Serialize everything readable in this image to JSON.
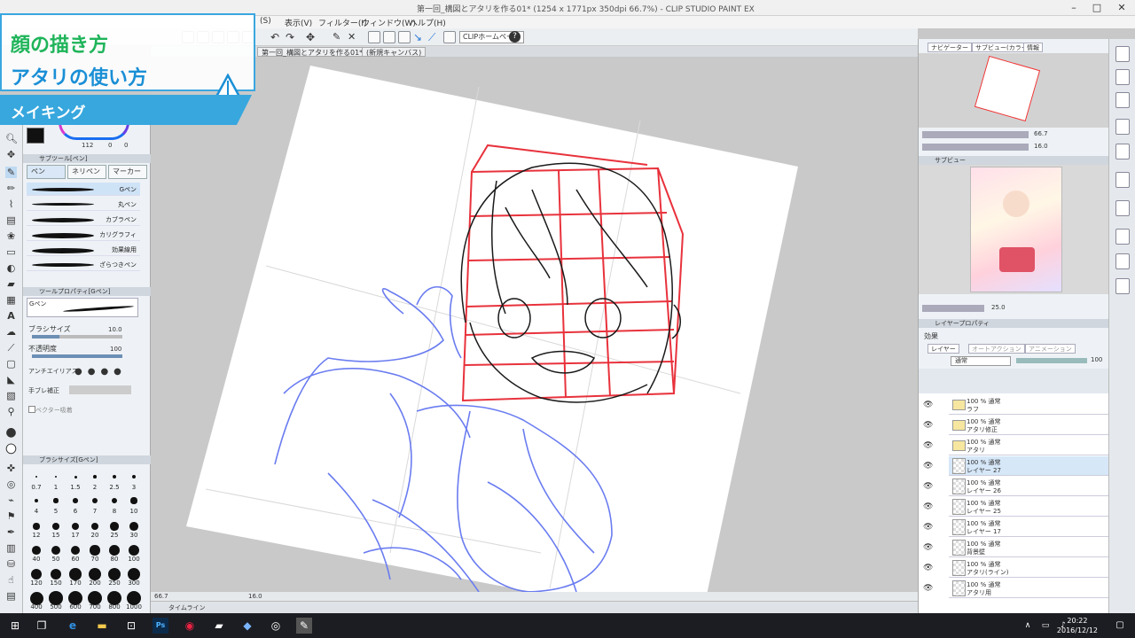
{
  "window": {
    "title": "第一回_構図とアタリを作る01* (1254 x 1771px 350dpi 66.7%) - CLIP STUDIO PAINT EX",
    "controls": [
      "–",
      "□",
      "✕"
    ]
  },
  "menu": {
    "items": [
      "(S)",
      "表示(V)",
      "フィルター(I)",
      "ウィンドウ(W)",
      "ヘルプ(H)"
    ]
  },
  "command_bar": {
    "clip_home_label": "CLIPホームページ",
    "help_label": "?"
  },
  "document_tabs": [
    "第一回_構図とアタリを作る01*",
    "(新規キャンバス)"
  ],
  "overlay": {
    "title": "顔の描き方",
    "subtitle": "アタリの使い方",
    "band": "メイキング"
  },
  "color_panel": {
    "values": [
      "112",
      "0",
      "0"
    ]
  },
  "subtool_panel": {
    "header": "サブツール[ペン]",
    "tabs": [
      "ペン",
      "ネリペン",
      "マーカー"
    ],
    "brushes": [
      "Gペン",
      "丸ペン",
      "カブラペン",
      "カリグラフィ",
      "効果線用",
      "ざらつきペン"
    ]
  },
  "tool_property": {
    "header": "ツールプロパティ[Gペン]",
    "brush_name": "Gペン",
    "rows": [
      {
        "label": "ブラシサイズ",
        "value": "10.0"
      },
      {
        "label": "不透明度",
        "value": "100"
      },
      {
        "label": "アンチエイリアス",
        "value": ""
      },
      {
        "label": "手ブレ補正",
        "value": ""
      },
      {
        "label": "ベクター吸着",
        "value": ""
      }
    ]
  },
  "brush_size_panel": {
    "header": "ブラシサイズ[Gペン]",
    "sizes_row1": [
      "0.7",
      "1",
      "1.5",
      "2",
      "2.5",
      "3"
    ],
    "sizes_row2": [
      "4",
      "5",
      "6",
      "7",
      "8",
      "10"
    ],
    "sizes_row3": [
      "12",
      "15",
      "17",
      "20",
      "25",
      "30"
    ],
    "sizes_row4": [
      "40",
      "50",
      "60",
      "70",
      "80",
      "100"
    ],
    "sizes_row5": [
      "120",
      "150",
      "170",
      "200",
      "250",
      "300"
    ],
    "sizes_row6": [
      "400",
      "500",
      "600",
      "700",
      "800",
      "1000"
    ]
  },
  "status": {
    "zoom": "66.7",
    "angle": "16.0",
    "timeline_label": "タイムライン"
  },
  "navigator": {
    "tabs": [
      "ナビゲーター",
      "サブビュー(カラー)",
      "情報"
    ],
    "zoom": "66.7",
    "angle": "16.0"
  },
  "subview": {
    "header": "サブビュー",
    "zoom": "25.0"
  },
  "layer_property": {
    "header": "レイヤープロパティ",
    "effect_label": "効果"
  },
  "layers_panel": {
    "tabs": [
      "レイヤー",
      "オートアクション",
      "アニメーション"
    ],
    "blend_mode": "通常",
    "opacity": "100",
    "layers": [
      {
        "pct": "100 % 通常",
        "name": "ラフ",
        "folder": true
      },
      {
        "pct": "100 % 通常",
        "name": "アタリ修正",
        "folder": true
      },
      {
        "pct": "100 % 通常",
        "name": "アタリ",
        "folder": true
      },
      {
        "pct": "100 % 通常",
        "name": "レイヤー 27",
        "folder": false
      },
      {
        "pct": "100 % 通常",
        "name": "レイヤー 26",
        "folder": false
      },
      {
        "pct": "100 % 通常",
        "name": "レイヤー 25",
        "folder": false
      },
      {
        "pct": "100 % 通常",
        "name": "レイヤー 17",
        "folder": false
      },
      {
        "pct": "100 % 通常",
        "name": "背景壁",
        "folder": false
      },
      {
        "pct": "100 % 通常",
        "name": "アタリ(ライン)",
        "folder": false
      },
      {
        "pct": "100 % 通常",
        "name": "アタリ用",
        "folder": false
      }
    ]
  },
  "taskbar": {
    "time": "20:22",
    "date": "2016/12/12",
    "icons": [
      "start-icon",
      "taskview-icon",
      "edge-icon",
      "explorer-icon",
      "store-icon",
      "photoshop-icon",
      "app-icon",
      "app2-icon",
      "app3-icon",
      "app4-icon",
      "clipstudio-icon"
    ]
  },
  "accent_colors": {
    "overlay_green": "#1fb45a",
    "overlay_blue": "#1a8fd6",
    "overlay_band": "#37a7de",
    "sketch_red": "#e8323c",
    "sketch_blue": "#6a7cf0"
  }
}
